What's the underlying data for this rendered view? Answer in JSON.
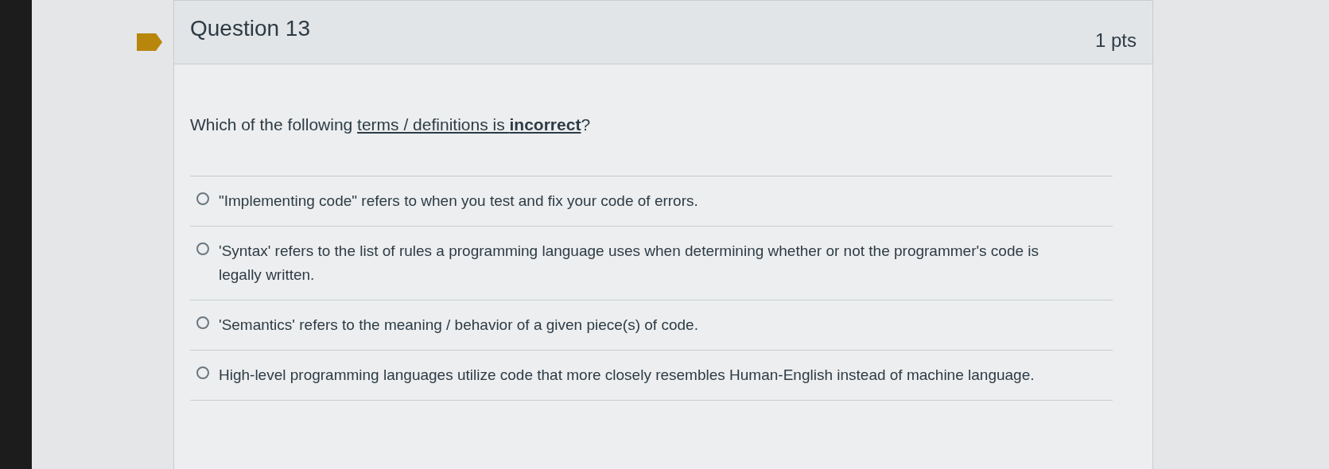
{
  "question": {
    "title": "Question 13",
    "points": "1 pts",
    "flagged": true,
    "prompt": [
      {
        "kind": "plain",
        "text": "Which of the following "
      },
      {
        "kind": "underline",
        "text": "terms / definitions is "
      },
      {
        "kind": "underline-bold",
        "text": "incorrect"
      },
      {
        "kind": "plain",
        "text": "?"
      }
    ],
    "answers": [
      {
        "text": "\"Implementing code\" refers to when you test and fix your code of errors.",
        "selected": false
      },
      {
        "text": "'Syntax' refers to the list of rules a programming language uses when determining whether or not the programmer's code is legally written.",
        "selected": false
      },
      {
        "text": "'Semantics' refers to the meaning / behavior of a given piece(s) of code.",
        "selected": false
      },
      {
        "text": "High-level programming languages utilize code that more closely resembles Human-English instead of machine language.",
        "selected": false
      }
    ]
  }
}
